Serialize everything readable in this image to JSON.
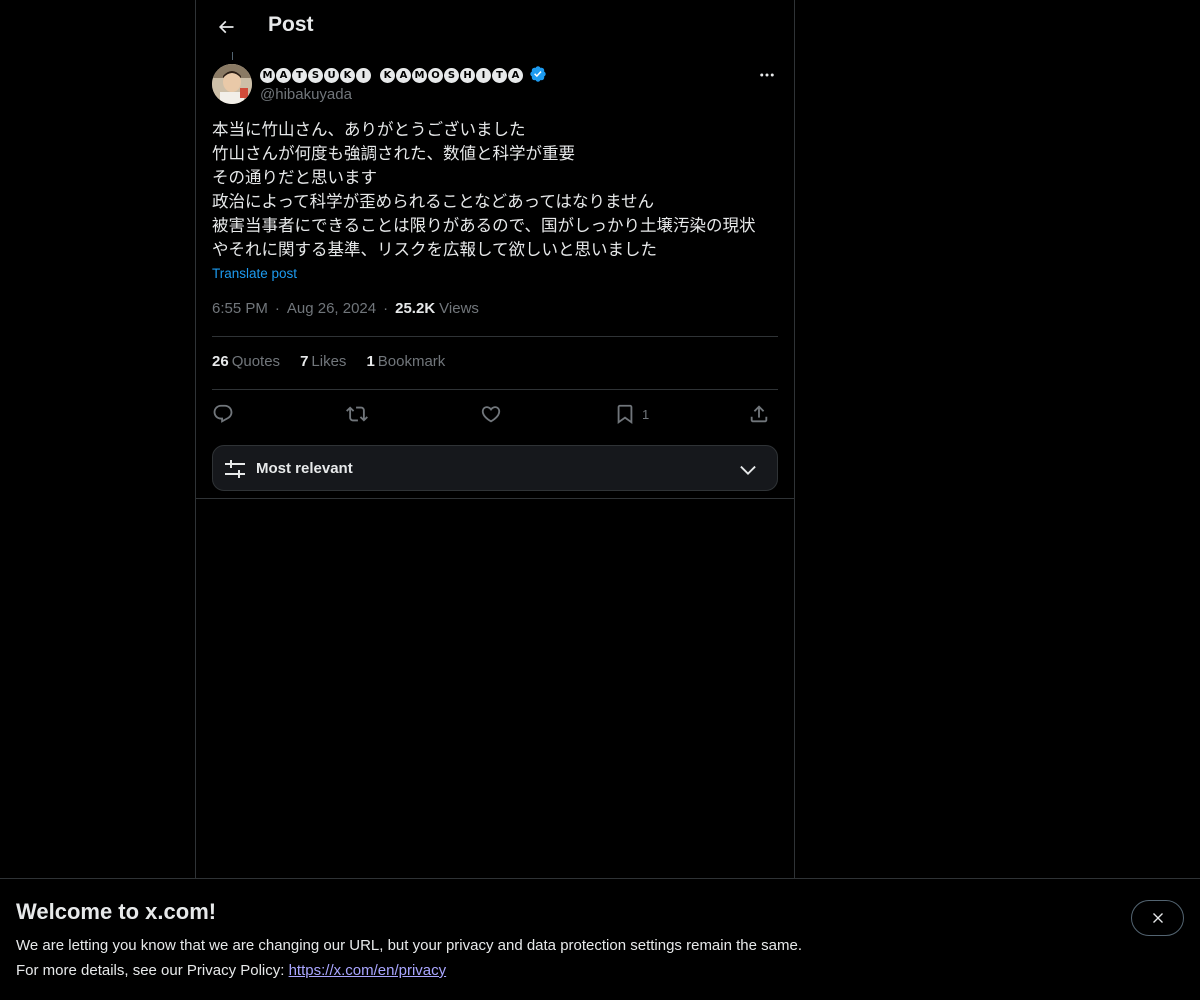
{
  "header": {
    "back_icon": "arrow-left-icon",
    "title": "Post"
  },
  "post": {
    "author": {
      "display_name_chars": [
        "M",
        "A",
        "T",
        "S",
        "U",
        "K",
        "I",
        " ",
        "K",
        "A",
        "M",
        "O",
        "S",
        "H",
        "I",
        "T",
        "A"
      ],
      "verified_icon": "verified-badge-icon",
      "verified_color": "#1d9bf0",
      "handle": "@hibakuyada"
    },
    "more_icon": "more-horizontal-icon",
    "text_lines": [
      "本当に竹山さん、ありがとうございました",
      "竹山さんが何度も強調された、数値と科学が重要",
      "その通りだと思います",
      "政治によって科学が歪められることなどあってはなりません",
      "被害当事者にできることは限りがあるので、国がしっかり土壌汚染の現状",
      "やそれに関する基準、リスクを広報して欲しいと思いました"
    ],
    "translate_label": "Translate post",
    "time": "6:55 PM",
    "date": "Aug 26, 2024",
    "views_count": "25.2K",
    "views_label": "Views",
    "stats": {
      "quotes_count": "26",
      "quotes_label": "Quotes",
      "likes_count": "7",
      "likes_label": "Likes",
      "bookmarks_count": "1",
      "bookmarks_label": "Bookmark"
    },
    "actions": {
      "reply_icon": "reply-icon",
      "repost_icon": "repost-icon",
      "like_icon": "heart-icon",
      "bookmark_icon": "bookmark-icon",
      "bookmark_count": "1",
      "share_icon": "share-icon"
    }
  },
  "sort": {
    "icon": "sliders-icon",
    "label": "Most relevant",
    "chevron_icon": "chevron-down-icon"
  },
  "banner": {
    "title": "Welcome to x.com!",
    "line1": "We are letting you know that we are changing our URL, but your privacy and data protection settings remain the same.",
    "line2_prefix": "For more details, see our Privacy Policy: ",
    "link": "https://x.com/en/privacy",
    "close_icon": "close-icon"
  },
  "colors": {
    "background": "#000000",
    "text": "#e7e9ea",
    "muted": "#71767b",
    "accent": "#1d9bf0",
    "border": "#2f3336",
    "link_visited": "#a9a6ff"
  }
}
